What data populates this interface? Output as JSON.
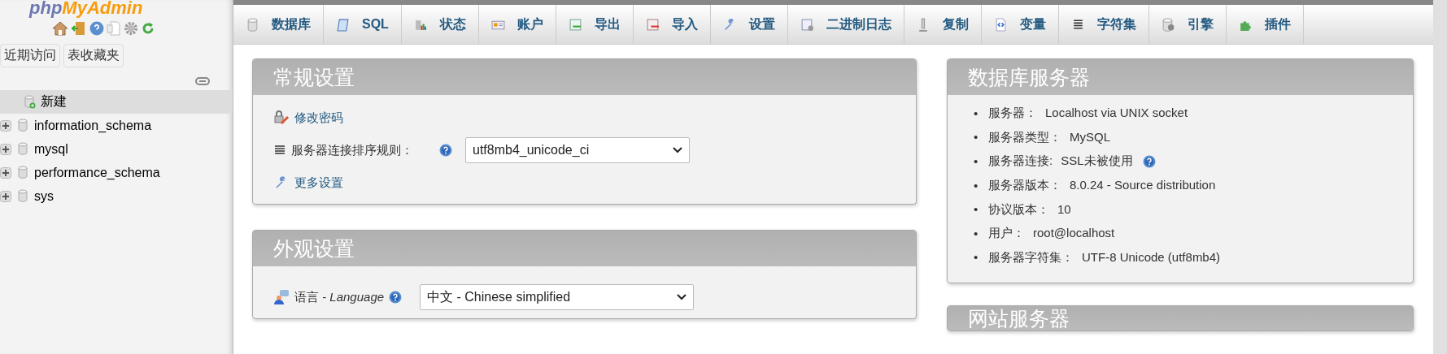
{
  "logo": {
    "part_1": "php",
    "part_2": "MyAdmin"
  },
  "sidebar": {
    "tabs": [
      {
        "label": "近期访问"
      },
      {
        "label": "表收藏夹"
      }
    ],
    "tree": [
      {
        "label": "新建",
        "kind": "new",
        "selected": true
      },
      {
        "label": "information_schema",
        "kind": "db",
        "selected": false
      },
      {
        "label": "mysql",
        "kind": "db",
        "selected": false
      },
      {
        "label": "performance_schema",
        "kind": "db",
        "selected": false
      },
      {
        "label": "sys",
        "kind": "db",
        "selected": false
      }
    ]
  },
  "tabs": [
    {
      "label": "数据库"
    },
    {
      "label": "SQL"
    },
    {
      "label": "状态"
    },
    {
      "label": "账户"
    },
    {
      "label": "导出"
    },
    {
      "label": "导入"
    },
    {
      "label": "设置"
    },
    {
      "label": "二进制日志"
    },
    {
      "label": "复制"
    },
    {
      "label": "变量"
    },
    {
      "label": "字符集"
    },
    {
      "label": "引擎"
    },
    {
      "label": "插件"
    }
  ],
  "general_settings": {
    "title": "常规设置",
    "change_password": "修改密码",
    "collation_label": "服务器连接排序规则：",
    "collation_value": "utf8mb4_unicode_ci",
    "more_settings": "更多设置"
  },
  "appearance_settings": {
    "title": "外观设置",
    "language_label": "语言 - *Language*",
    "language_value": "中文 - Chinese simplified"
  },
  "database_server": {
    "title": "数据库服务器",
    "items": [
      {
        "bullet": "•",
        "label": "服务器：",
        "value": "Localhost via UNIX socket",
        "help": false
      },
      {
        "bullet": "•",
        "label": "服务器类型：",
        "value": "MySQL",
        "help": false
      },
      {
        "bullet": "•",
        "label": "服务器连接:",
        "value": "SSL未被使用",
        "help": true
      },
      {
        "bullet": "•",
        "label": "服务器版本：",
        "value": "8.0.24 - Source distribution",
        "help": false
      },
      {
        "bullet": "•",
        "label": "协议版本：",
        "value": "10",
        "help": false
      },
      {
        "bullet": "•",
        "label": "用户：",
        "value": "root@localhost",
        "help": false
      },
      {
        "bullet": "•",
        "label": "服务器字符集：",
        "value": "UTF-8 Unicode (utf8mb4)",
        "help": false
      }
    ]
  },
  "web_server": {
    "title": "网站服务器"
  }
}
